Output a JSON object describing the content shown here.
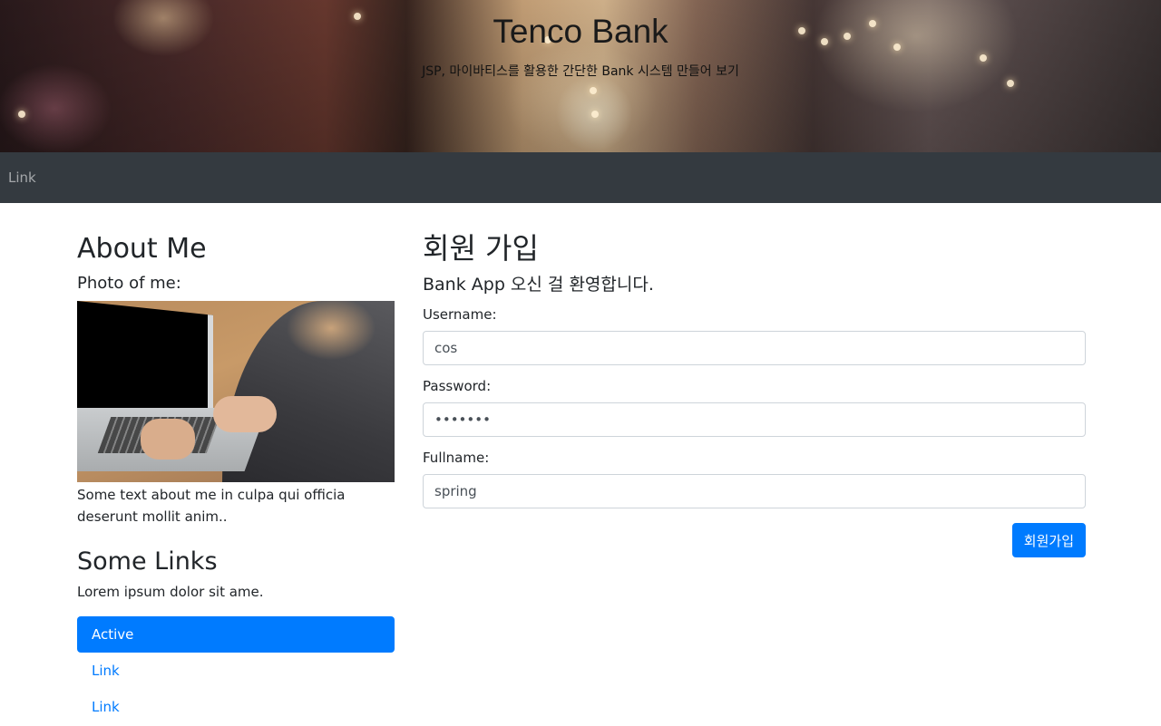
{
  "header": {
    "title": "Tenco Bank",
    "subtitle": "JSP, 마이바티스를 활용한 간단한 Bank 시스템 만들어 보기"
  },
  "navbar": {
    "link_label": "Link"
  },
  "sidebar": {
    "about_title": "About Me",
    "photo_label": "Photo of me:",
    "about_text": "Some text about me in culpa qui officia deserunt mollit anim..",
    "links_title": "Some Links",
    "links_text": "Lorem ipsum dolor sit ame.",
    "links": [
      {
        "label": "Active"
      },
      {
        "label": "Link"
      },
      {
        "label": "Link"
      }
    ]
  },
  "signup": {
    "title": "회원 가입",
    "welcome": "Bank App 오신 걸 환영합니다.",
    "username_label": "Username:",
    "username_value": "cos",
    "password_label": "Password:",
    "password_value": "1234567",
    "fullname_label": "Fullname:",
    "fullname_value": "spring",
    "submit_label": "회원가입"
  },
  "colors": {
    "primary": "#007bff",
    "navbar_bg": "#343a40"
  }
}
